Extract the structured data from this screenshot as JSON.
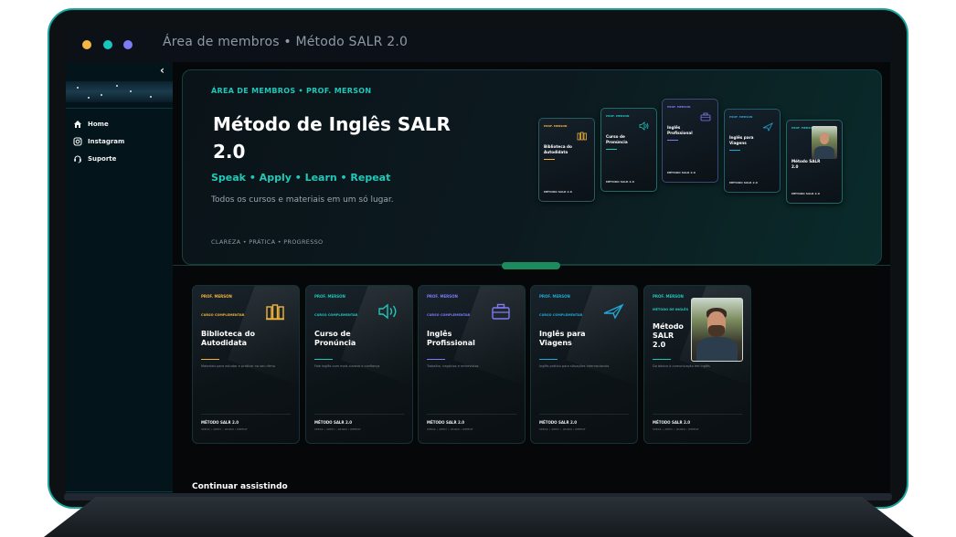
{
  "window": {
    "title": "Área de membros • Método SALR 2.0"
  },
  "sidebar": {
    "collapse_glyph": "‹",
    "items": [
      {
        "label": "Home",
        "icon": "home-icon"
      },
      {
        "label": "Instagram",
        "icon": "instagram-icon"
      },
      {
        "label": "Suporte",
        "icon": "headset-icon"
      }
    ]
  },
  "hero": {
    "eyebrow": "ÁREA DE MEMBROS • PROF. MERSON",
    "title": "Método de Inglês SALR 2.0",
    "tagline": "Speak • Apply • Learn • Repeat",
    "subtitle": "Todos os cursos e materiais em um só lugar.",
    "footer": "CLAREZA • PRÁTICA • PROGRESSO"
  },
  "section_pill": "",
  "courses": [
    {
      "prof": "PROF. MERSON",
      "kind": "CURSO COMPLEMENTAR",
      "title": "Biblioteca do Autodidata",
      "desc": "Materiais para estudar e praticar no seu ritmo",
      "footer": "MÉTODO SALR 2.0",
      "meta": "SPEAK • APPLY • LEARN • REPEAT",
      "accent": "#f0b43a",
      "icon": "books-icon"
    },
    {
      "prof": "PROF. MERSON",
      "kind": "CURSO COMPLEMENTAR",
      "title": "Curso de Pronúncia",
      "desc": "Fale inglês com mais clareza e confiança",
      "footer": "MÉTODO SALR 2.0",
      "meta": "SPEAK • APPLY • LEARN • REPEAT",
      "accent": "#21c6b9",
      "icon": "speaker-icon"
    },
    {
      "prof": "PROF. MERSON",
      "kind": "CURSO COMPLEMENTAR",
      "title": "Inglês Profissional",
      "desc": "Trabalho, negócios e entrevistas",
      "footer": "MÉTODO SALR 2.0",
      "meta": "SPEAK • APPLY • LEARN • REPEAT",
      "accent": "#7d7cf6",
      "icon": "briefcase-icon"
    },
    {
      "prof": "PROF. MERSON",
      "kind": "CURSO COMPLEMENTAR",
      "title": "Inglês para Viagens",
      "desc": "Inglês prático para situações internacionais",
      "footer": "MÉTODO SALR 2.0",
      "meta": "SPEAK • APPLY • LEARN • REPEAT",
      "accent": "#21a9d6",
      "icon": "plane-icon"
    },
    {
      "prof": "PROF. MERSON",
      "kind": "MÉTODO DE INGLÊS",
      "title": "Método SALR 2.0",
      "desc": "Do básico à comunicação em inglês",
      "footer": "MÉTODO SALR 2.0",
      "meta": "SPEAK • APPLY • LEARN • REPEAT",
      "accent": "#21c6b9",
      "icon": "photo"
    }
  ],
  "continue_heading": "Continuar assistindo",
  "colors": {
    "accent_teal": "#21c6b9",
    "bg": "#050709",
    "sidebar": "#03141b"
  }
}
